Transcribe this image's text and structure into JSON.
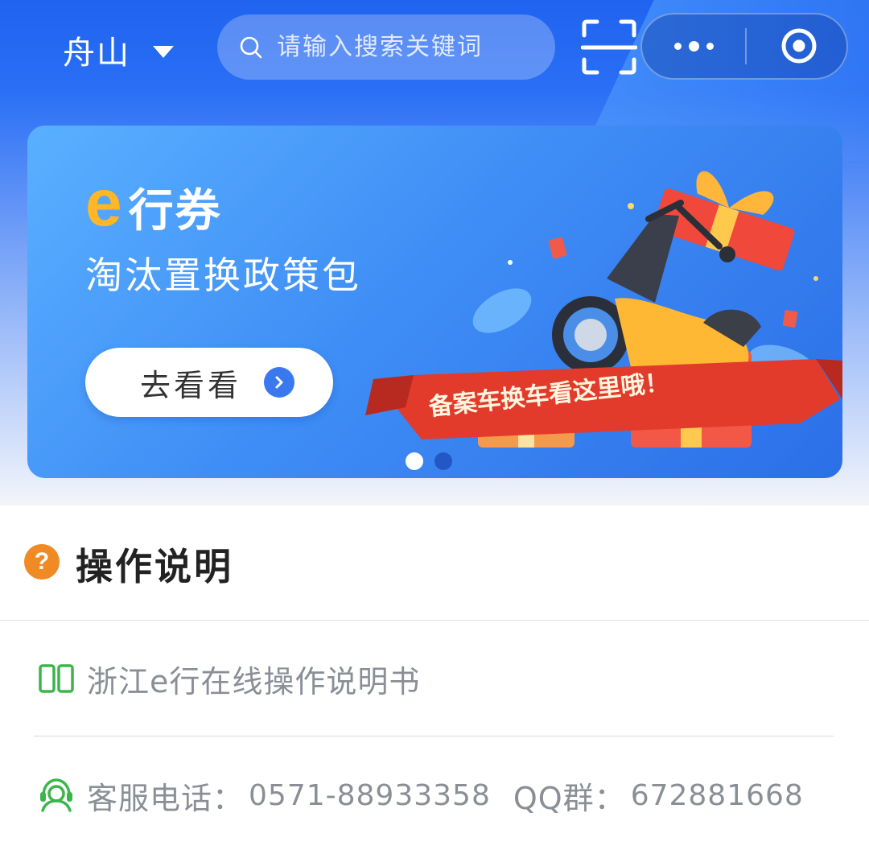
{
  "header": {
    "city": "舟山",
    "search_placeholder": "请输入搜索关键词"
  },
  "banner": {
    "title_e": "e",
    "title": "行券",
    "subtitle": "淘汰置换政策包",
    "button_label": "去看看",
    "ribbon_text": "备案车换车看这里哦！",
    "pagination": {
      "current": 1,
      "total": 2
    }
  },
  "instructions": {
    "title": "操作说明",
    "manual_link": "浙江e行在线操作说明书",
    "service_label": "客服电话：",
    "service_phone": "0571-88933358",
    "qq_label": "QQ群：",
    "qq_number": "672881668"
  },
  "colors": {
    "brand_blue": "#2a6ff5",
    "accent_orange": "#f08a24",
    "icon_green": "#3bb54a",
    "text_gray": "#8a8f96"
  }
}
